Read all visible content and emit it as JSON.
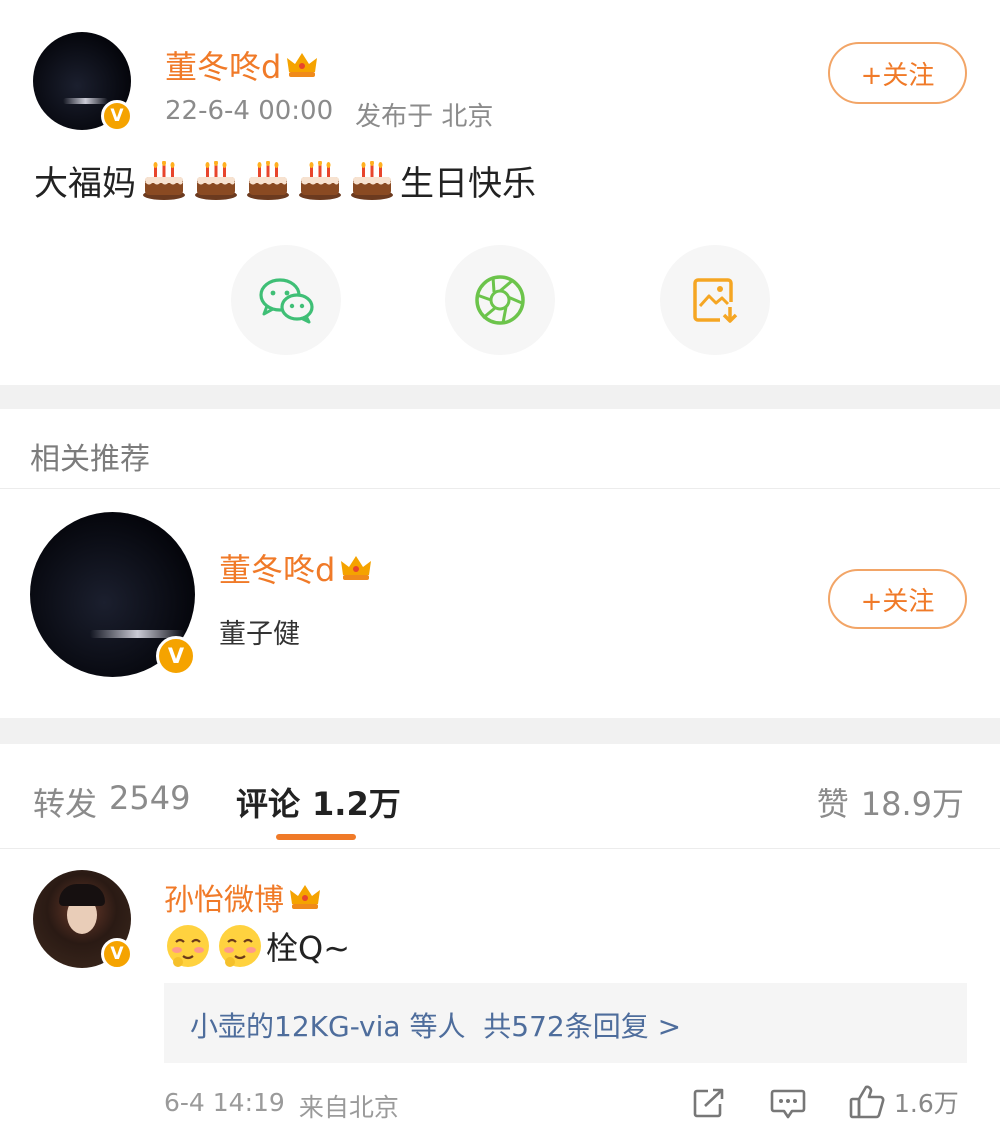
{
  "post": {
    "author_name": "董冬咚d",
    "meta_time": "22-6-4 00:00",
    "meta_location": "发布于 北京",
    "follow_label": "+关注",
    "text_prefix": "大福妈",
    "text_suffix": "生日快乐",
    "emoji_name": "cake-emoji",
    "emoji_count": 5
  },
  "share": {
    "items": [
      "wechat-icon",
      "moments-icon",
      "save-image-icon"
    ]
  },
  "related": {
    "section_title": "相关推荐",
    "user_name": "董冬咚d",
    "user_desc": "董子健",
    "follow_label": "+关注"
  },
  "tabs": {
    "repost_label": "转发",
    "repost_count": "2549",
    "comment_label": "评论",
    "comment_count": "1.2万",
    "like_label": "赞",
    "like_count": "18.9万"
  },
  "comment": {
    "author_name": "孙怡微博",
    "text": "栓Q~",
    "emoji_name": "blush-emoji",
    "replies_users": "小壶的12KG-via 等人",
    "replies_count": "共572条回复 >",
    "time": "6-4 14:19",
    "source": "来自北京",
    "like_count": "1.6万"
  },
  "colors": {
    "accent": "#f07a28",
    "badge": "#f5a300",
    "link": "#4e6d9c",
    "wechat": "#3fbf76",
    "moments": "#6cc44b",
    "save": "#f5a623"
  }
}
